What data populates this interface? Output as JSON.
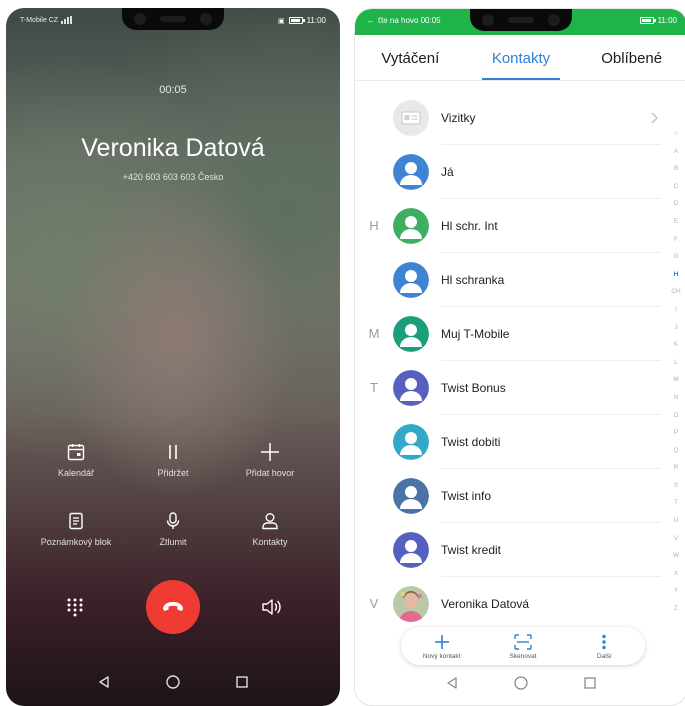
{
  "left_phone": {
    "status_bar": {
      "carrier": "T-Mobile CZ",
      "time": "11:00"
    },
    "call": {
      "timer": "00:05",
      "caller_name": "Veronika Datová",
      "caller_number": "+420 603 603 603  Česko"
    },
    "actions": [
      {
        "label": "Kalendář",
        "icon": "calendar-icon"
      },
      {
        "label": "Přidržet",
        "icon": "pause-icon"
      },
      {
        "label": "Přidat hovor",
        "icon": "plus-icon"
      },
      {
        "label": "Poznámkový blok",
        "icon": "notepad-icon"
      },
      {
        "label": "Ztlumit",
        "icon": "microphone-icon"
      },
      {
        "label": "Kontakty",
        "icon": "person-icon"
      }
    ],
    "bottom_controls": {
      "dialpad_icon": "dialpad-icon",
      "end_call_icon": "end-call-icon",
      "speaker_icon": "speaker-icon"
    },
    "end_call_color": "#f03b35"
  },
  "right_phone": {
    "status_bar": {
      "back_text": "ťte na hovo 00:05",
      "time": "11:00",
      "bar_color": "#1fb44a"
    },
    "tabs": [
      {
        "label": "Vytáčení",
        "active": false
      },
      {
        "label": "Kontakty",
        "active": true
      },
      {
        "label": "Oblíbené",
        "active": false
      }
    ],
    "accent_color": "#2f7fd4",
    "contacts": [
      {
        "letter": "",
        "name": "Vizitky",
        "avatar": "business-card-icon"
      },
      {
        "letter": "",
        "name": "Já",
        "avatar": "person-avatar-blue"
      },
      {
        "letter": "H",
        "name": "Hl schr. Int",
        "avatar": "person-avatar-green"
      },
      {
        "letter": "",
        "name": "Hl schranka",
        "avatar": "person-avatar-blue"
      },
      {
        "letter": "M",
        "name": "Muj T-Mobile",
        "avatar": "person-avatar-teal"
      },
      {
        "letter": "T",
        "name": "Twist Bonus",
        "avatar": "person-avatar-indigo"
      },
      {
        "letter": "",
        "name": "Twist dobiti",
        "avatar": "person-avatar-cyan"
      },
      {
        "letter": "",
        "name": "Twist info",
        "avatar": "person-avatar-steel"
      },
      {
        "letter": "",
        "name": "Twist kredit",
        "avatar": "person-avatar-indigo"
      },
      {
        "letter": "V",
        "name": "Veronika Datová",
        "avatar": "photo-avatar"
      }
    ],
    "index_letters": [
      "☆",
      "A",
      "B",
      "C",
      "D",
      "E",
      "F",
      "G",
      "H",
      "CH",
      "I",
      "J",
      "K",
      "L",
      "M",
      "N",
      "O",
      "P",
      "Q",
      "R",
      "S",
      "T",
      "U",
      "V",
      "W",
      "X",
      "Y",
      "Z"
    ],
    "index_highlight": "H",
    "bottom_actions": [
      {
        "label": "Nový kontakt",
        "icon": "plus-icon"
      },
      {
        "label": "Skenovat",
        "icon": "scan-icon"
      },
      {
        "label": "Další",
        "icon": "more-vertical-icon"
      }
    ]
  }
}
